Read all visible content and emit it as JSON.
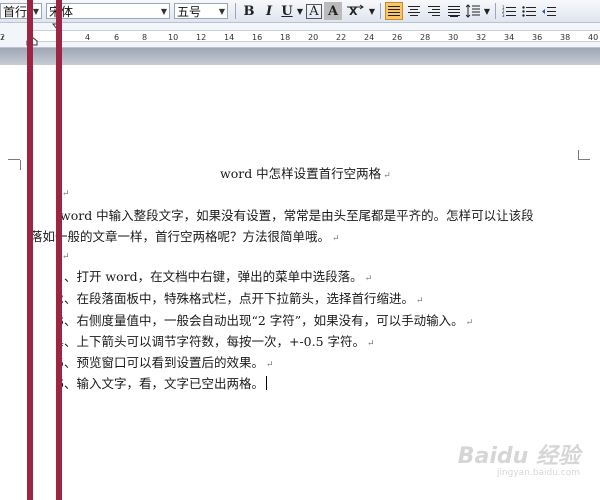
{
  "toolbar": {
    "style_combo": "首行",
    "font_combo": "宋体",
    "size_combo": "五号",
    "bold": "B",
    "italic": "I",
    "underline": "U",
    "font_color_a": "A",
    "shade_a": "A"
  },
  "ruler": {
    "ticks": [
      "2",
      "2",
      "4",
      "6",
      "8",
      "10",
      "12",
      "14",
      "16",
      "18",
      "20",
      "22",
      "24",
      "26",
      "28",
      "30",
      "32",
      "34",
      "36",
      "38",
      "40"
    ]
  },
  "document": {
    "title": "word 中怎样设置首行空两格",
    "intro_line1": "word 中输入整段文字，如果没有设置，常常是由头至尾都是平齐的。怎样可以让该段",
    "intro_line2": "落如一般的文章一样，首行空两格呢？方法很简单哦。",
    "steps": [
      "1、打开 word，在文档中右键，弹出的菜单中选段落。",
      "2、在段落面板中，特殊格式栏，点开下拉箭头，选择首行缩进。",
      "3、右侧度量值中，一般会自动出现“2 字符”，如果没有，可以手动输入。",
      "4、上下箭头可以调节字符数，每按一次，+-0.5 字符。",
      "5、预览窗口可以看到设置后的效果。",
      "6、输入文字，看，文字已空出两格。"
    ],
    "para_mark": "↵"
  },
  "watermark": {
    "text": "Baidu 经验",
    "sub": "jingyan.baidu.com"
  },
  "colors": {
    "red_bar": "#9e2443",
    "active_button": "#f8c56b"
  }
}
